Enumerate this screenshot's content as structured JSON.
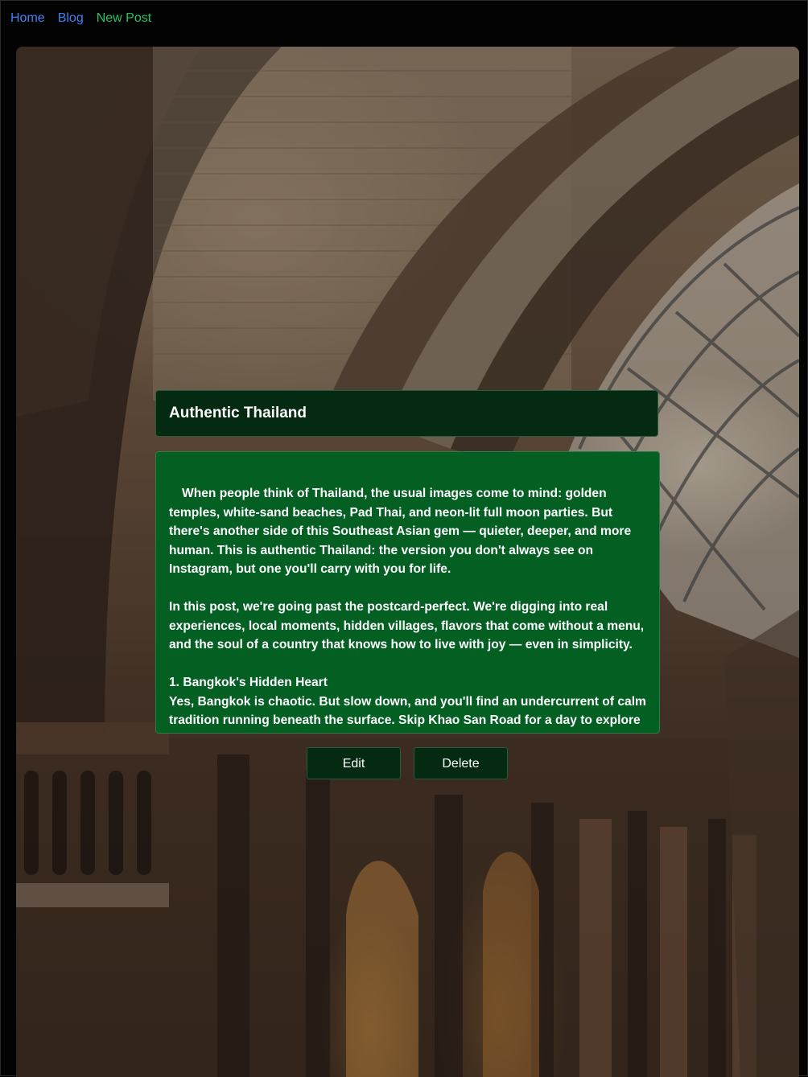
{
  "nav": {
    "home": "Home",
    "blog": "Blog",
    "new_post": "New Post"
  },
  "post": {
    "title": "Authentic Thailand",
    "paragraphs": [
      "When people think of Thailand, the usual images come to mind: golden temples, white-sand beaches, Pad Thai, and neon-lit full moon parties. But there's another side of this Southeast Asian gem — quieter, deeper, and more human. This is authentic Thailand: the version you don't always see on Instagram, but one you'll carry with you for life.",
      "In this post, we're going past the postcard-perfect. We're digging into real experiences, local moments, hidden villages, flavors that come without a menu, and the soul of a country that knows how to live with joy — even in simplicity."
    ],
    "section_heading": "1. Bangkok's Hidden Heart",
    "section_text": "Yes, Bangkok is chaotic. But slow down, and you'll find an undercurrent of calm tradition running beneath the surface. Skip Khao San Road for a day to explore"
  },
  "actions": {
    "edit": "Edit",
    "delete": "Delete"
  },
  "colors": {
    "nav_link": "#3b82f6",
    "nav_new_post": "#22c55e",
    "title_card_bg": "#042b12",
    "content_card_bg": "#035f22",
    "button_bg": "#042b12"
  }
}
